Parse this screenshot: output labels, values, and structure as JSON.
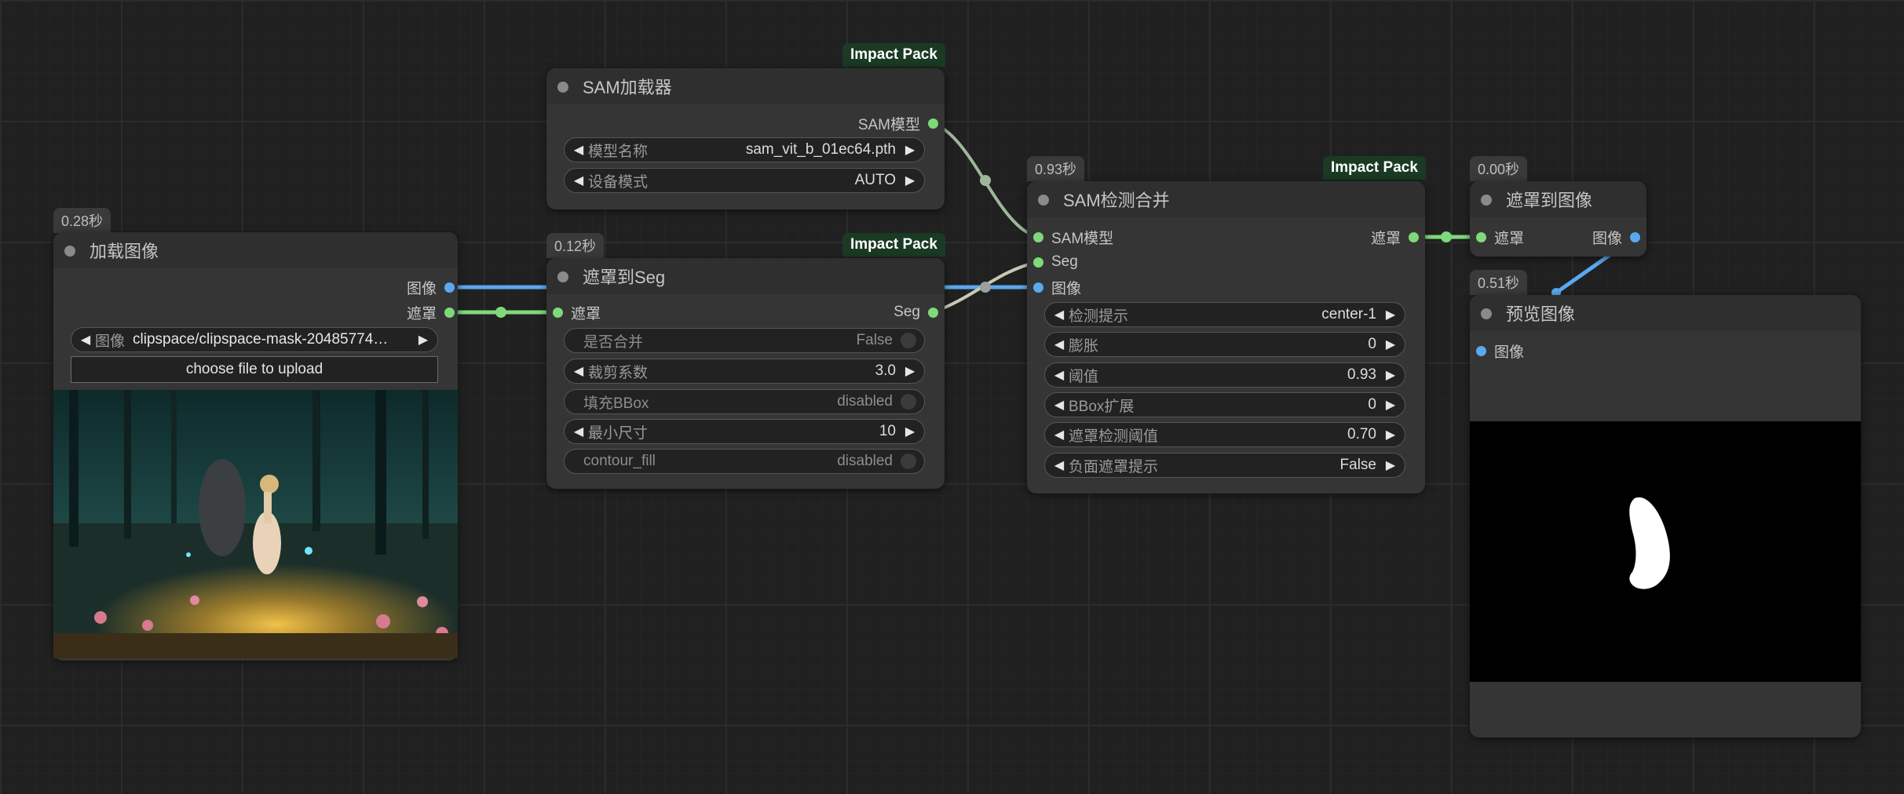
{
  "colors": {
    "image_link": "#5aa9f0",
    "mask_link": "#7fd97a",
    "sam_link": "#9fb69c",
    "seg_link": "#c9c9b8",
    "pack_badge": "#1a3a24"
  },
  "nodes": {
    "load_image": {
      "time": "0.28秒",
      "title": "加载图像",
      "outputs": [
        "图像",
        "遮罩"
      ],
      "image_widget": {
        "label": "图像",
        "value": "clipspace/clipspace-mask-20485774…"
      },
      "upload_label": "choose file to upload"
    },
    "sam_loader": {
      "pack": "Impact Pack",
      "title": "SAM加载器",
      "output": "SAM模型",
      "widgets": [
        {
          "label": "模型名称",
          "value": "sam_vit_b_01ec64.pth"
        },
        {
          "label": "设备模式",
          "value": "AUTO"
        }
      ]
    },
    "mask_to_seg": {
      "time": "0.12秒",
      "pack": "Impact Pack",
      "title": "遮罩到Seg",
      "input": "遮罩",
      "output": "Seg",
      "widgets": [
        {
          "label": "是否合并",
          "value": "False"
        },
        {
          "label": "裁剪系数",
          "value": "3.0"
        },
        {
          "label": "填充BBox",
          "value": "disabled"
        },
        {
          "label": "最小尺寸",
          "value": "10"
        },
        {
          "label": "contour_fill",
          "value": "disabled"
        }
      ]
    },
    "sam_detect": {
      "time": "0.93秒",
      "pack": "Impact Pack",
      "title": "SAM检测合并",
      "inputs": [
        "SAM模型",
        "Seg",
        "图像"
      ],
      "output": "遮罩",
      "widgets": [
        {
          "label": "检测提示",
          "value": "center-1"
        },
        {
          "label": "膨胀",
          "value": "0"
        },
        {
          "label": "阈值",
          "value": "0.93"
        },
        {
          "label": "BBox扩展",
          "value": "0"
        },
        {
          "label": "遮罩检测阈值",
          "value": "0.70"
        },
        {
          "label": "负面遮罩提示",
          "value": "False"
        }
      ]
    },
    "mask_to_image": {
      "time": "0.00秒",
      "title": "遮罩到图像",
      "input": "遮罩",
      "output": "图像"
    },
    "preview_image": {
      "time": "0.51秒",
      "title": "预览图像",
      "input": "图像"
    }
  }
}
